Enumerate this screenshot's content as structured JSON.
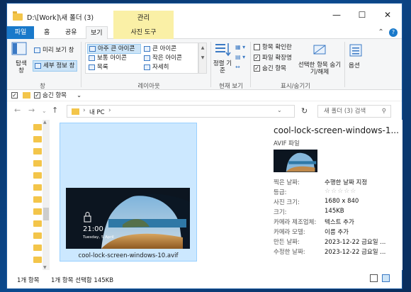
{
  "window": {
    "title": "D:\\[Work]\\새 폴더 (3)",
    "context_tab_label": "관리"
  },
  "tabs": {
    "file": "파일",
    "home": "홈",
    "share": "공유",
    "view": "보기",
    "picture_tools": "사진 도구"
  },
  "ribbon": {
    "pane": {
      "nav_pane": "탐색 창",
      "preview_pane": "미리 보기 창",
      "details_pane": "세부 정보 창",
      "group_label": "창"
    },
    "layout": {
      "items": [
        "아주 큰 아이콘",
        "큰 아이콘",
        "보통 아이콘",
        "작은 아이콘",
        "목록",
        "자세히"
      ],
      "group_label": "레이아웃"
    },
    "current_view": {
      "sort_by": "정렬 기준",
      "group_label": "현재 보기"
    },
    "show_hide": {
      "item_checkboxes": "항목 확인란",
      "file_extensions": "파일 확장명",
      "hidden_items": "숨긴 항목",
      "hide_selected": "선택한 항목 숨기기/해제",
      "group_label": "표시/숨기기"
    },
    "options": {
      "label": "옵션"
    }
  },
  "qat": {
    "hidden_items": "숨긴 항목"
  },
  "address": {
    "path_root": "내 PC",
    "search_placeholder": "새 폴더 (3) 검색"
  },
  "file": {
    "name": "cool-lock-screen-windows-10.avif",
    "thumb_time": "21:00",
    "thumb_date": "Tuesday, 5 April"
  },
  "preview": {
    "title": "cool-lock-screen-windows-1...",
    "type": "AVIF 파일",
    "rows": [
      {
        "k": "찍은 날짜:",
        "v": "수행한 날짜 지정"
      },
      {
        "k": "등급:",
        "v": "☆☆☆☆☆"
      },
      {
        "k": "사진 크기:",
        "v": "1680 x 840"
      },
      {
        "k": "크기:",
        "v": "145KB"
      },
      {
        "k": "카메라 제조업체:",
        "v": "텍스트 추가"
      },
      {
        "k": "카메라 모델:",
        "v": "이름 추가"
      },
      {
        "k": "만든 날짜:",
        "v": "2023-12-22 금요일 ..."
      },
      {
        "k": "수정한 날짜:",
        "v": "2023-12-22 금요일 ..."
      }
    ]
  },
  "status": {
    "count": "1개 항목",
    "selected": "1개 항목 선택함 145KB"
  },
  "colors": {
    "accent": "#1979ca",
    "selection": "#cce8ff",
    "context_tab": "#faf0a6"
  }
}
